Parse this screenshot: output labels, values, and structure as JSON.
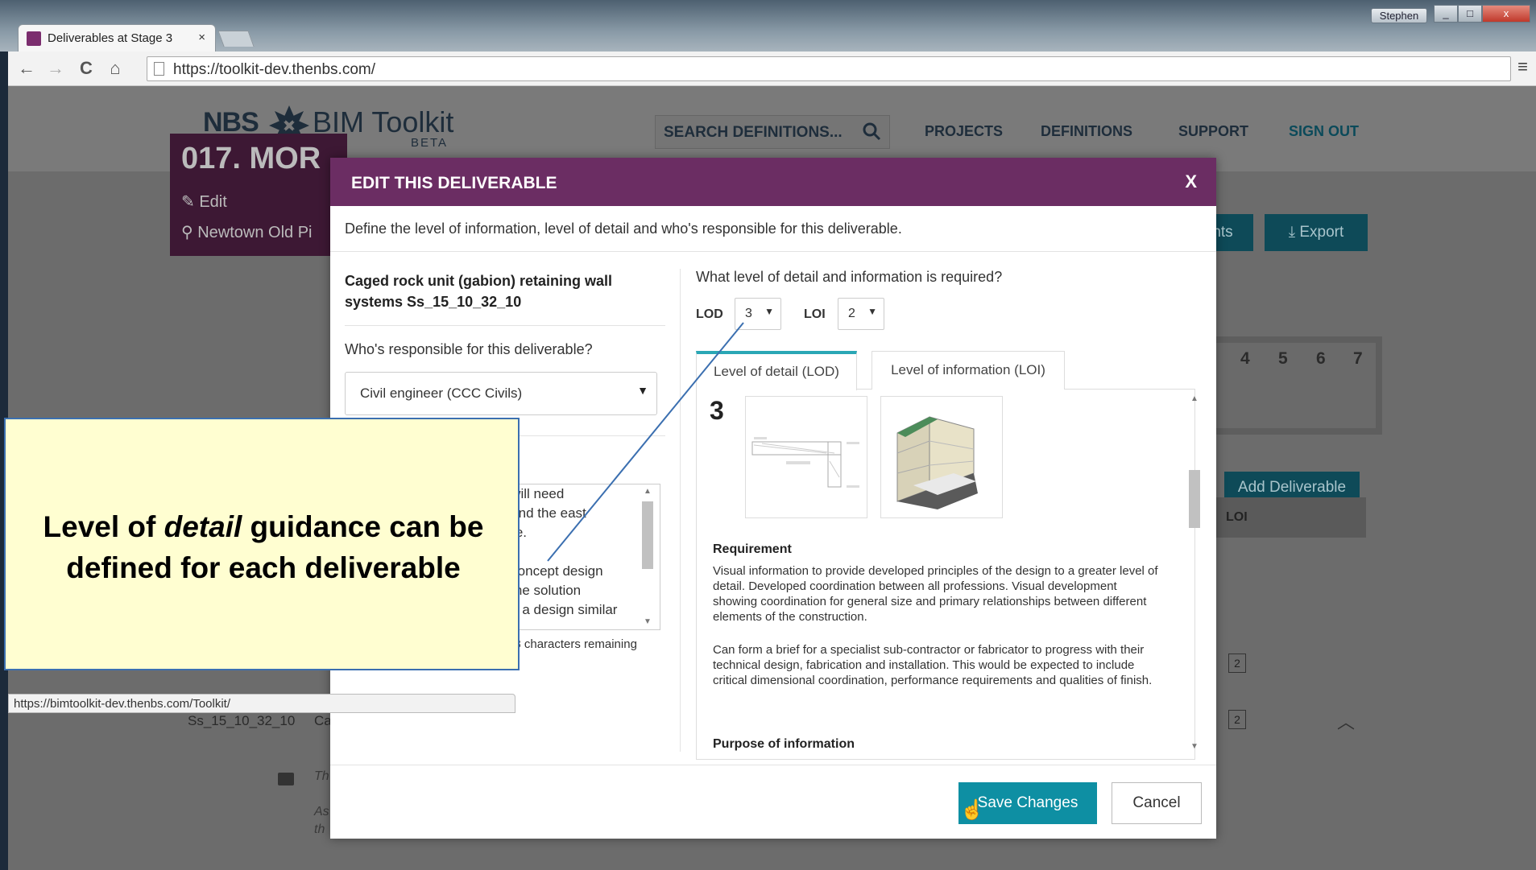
{
  "window": {
    "user": "Stephen",
    "min": "_",
    "restore": "□",
    "close": "x"
  },
  "browser": {
    "tab_title": "Deliverables at Stage 3",
    "tab_close": "×",
    "back": "←",
    "forward": "→",
    "reload": "C",
    "home": "⌂",
    "url": "https://toolkit-dev.thenbs.com/",
    "menu": "≡",
    "status_url": "https://bimtoolkit-dev.thenbs.com/Toolkit/"
  },
  "site": {
    "logo_nbs": "NBS",
    "logo_bim": "BIM Toolkit",
    "logo_beta": "BETA",
    "search_placeholder": "SEARCH DEFINITIONS...",
    "nav": [
      "PROJECTS",
      "DEFINITIONS",
      "SUPPORT",
      "SIGN OUT"
    ]
  },
  "project": {
    "title": "017. MOR",
    "edit": "Edit",
    "location": "Newtown Old Pi",
    "btn_nts": "nts",
    "btn_export": "Export"
  },
  "stages": [
    "4",
    "5",
    "6",
    "7"
  ],
  "table": {
    "add_btn": "Add Deliverable",
    "loi_header": "LOI",
    "loi_values": [
      "2",
      "2"
    ],
    "row_code": "Ss_15_10_32_10",
    "row_partial": "Ca",
    "ghost_1": "Th",
    "ghost_2": "As",
    "ghost_3": "th"
  },
  "modal": {
    "title": "EDIT THIS DELIVERABLE",
    "close": "X",
    "description": "Define the level of information, level of detail and who's responsible for this deliverable.",
    "deliverable_name": "Caged rock unit (gabion) retaining wall systems Ss_15_10_32_10",
    "responsible_label": "Who's responsible for this deliverable?",
    "responsible_value": "Civil engineer (CCC Civils)",
    "notes_lines": [
      "p will need",
      "n and the east",
      "ntre.",
      "e concept design",
      "e the solution",
      "hat a design similar"
    ],
    "chars_remaining": "48 characters remaining",
    "level_question": "What level of detail and information is required?",
    "lod_label": "LOD",
    "lod_value": "3",
    "loi_label": "LOI",
    "loi_value": "2",
    "tabs": [
      "Level of detail (LOD)",
      "Level of information (LOI)"
    ],
    "active_tab": 0,
    "lod_number": "3",
    "requirement_heading": "Requirement",
    "requirement_p1": "Visual information to provide developed principles of the design to a greater level of detail. Developed coordination between all professions. Visual development showing coordination for general size and primary relationships between different elements of the construction.",
    "requirement_p2": "Can form a brief for a specialist sub-contractor or fabricator to progress with their technical design, fabrication and installation. This would be expected to include critical dimensional coordination, performance requirements and qualities of finish.",
    "purpose_heading": "Purpose of information",
    "save": "Save Changes",
    "cancel": "Cancel"
  },
  "callout": {
    "pre": "Level of ",
    "em": "detail",
    "post": " guidance can be defined for each deliverable"
  },
  "colors": {
    "modal_header": "#6b2d63",
    "accent": "#0e8fa3",
    "callout_bg": "#fffed1"
  }
}
